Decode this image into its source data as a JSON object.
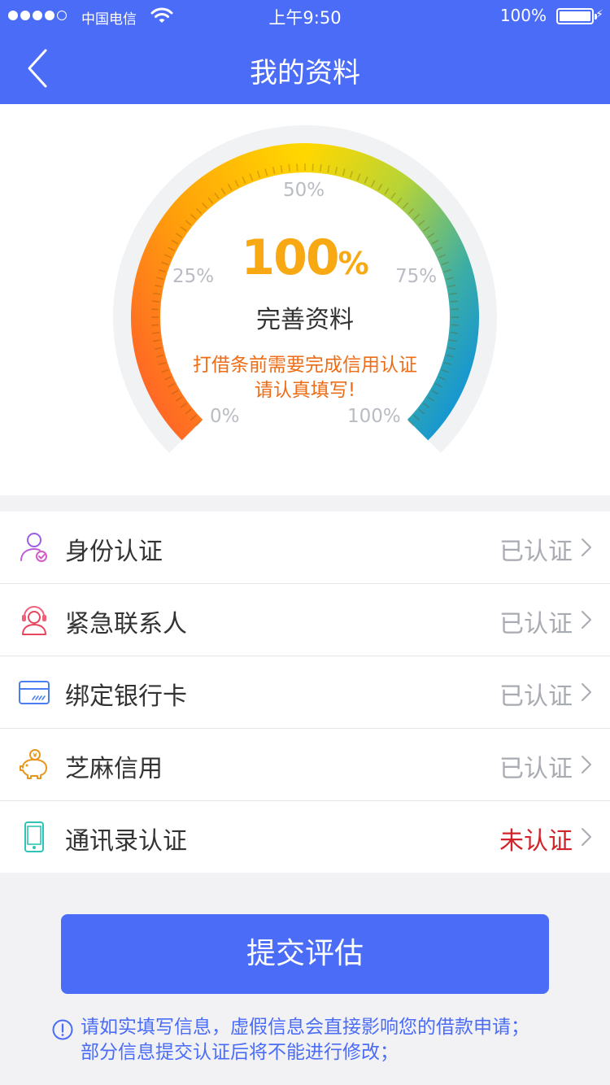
{
  "status_bar": {
    "carrier": "中国电信",
    "time": "上午9:50",
    "battery": "100%"
  },
  "nav": {
    "title": "我的资料"
  },
  "gauge": {
    "value_percent": 100,
    "value_number": "100",
    "value_unit": "%",
    "label": "完善资料",
    "note_line1": "打借条前需要完成信用认证",
    "note_line2": "请认真填写!",
    "ticks": {
      "p0": "0%",
      "p25": "25%",
      "p50": "50%",
      "p75": "75%",
      "p100": "100%"
    },
    "colors": {
      "start": "#ff6a1f",
      "mid": "#ffd700",
      "end": "#0a8fe0",
      "track": "#f1f2f4"
    }
  },
  "items": [
    {
      "label": "身份认证",
      "status": "已认证",
      "icon": "id-user-icon"
    },
    {
      "label": "紧急联系人",
      "status": "已认证",
      "icon": "contact-person-icon"
    },
    {
      "label": "绑定银行卡",
      "status": "已认证",
      "icon": "bank-card-icon"
    },
    {
      "label": "芝麻信用",
      "status": "已认证",
      "icon": "piggy-bank-icon"
    },
    {
      "label": "通讯录认证",
      "status": "未认证",
      "icon": "phone-icon"
    }
  ],
  "submit_label": "提交评估",
  "notice": {
    "line1": "请如实填写信息，虚假信息会直接影响您的借款申请；",
    "line2": "部分信息提交认证后将不能进行修改；"
  },
  "colors": {
    "primary": "#4a6cf7",
    "verified": "#a9abb2",
    "unverified": "#d0232a",
    "note": "#ee6c16"
  }
}
